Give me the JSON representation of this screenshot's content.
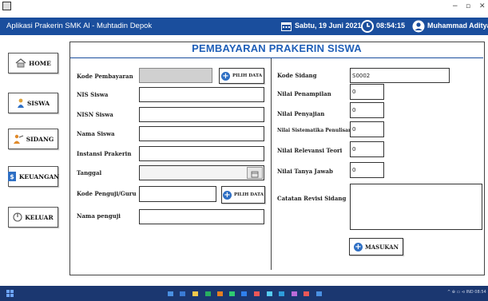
{
  "header": {
    "app_title": "Aplikasi Prakerin SMK Al - Muhtadin Depok",
    "date": "Sabtu, 19 Juni 2021",
    "time": "08:54:15",
    "user": "Muhammad Aditya"
  },
  "nav": {
    "home": "HOME",
    "siswa": "SISWA",
    "sidang": "SIDANG",
    "keuangan": "KEUANGAN",
    "keluar": "KELUAR"
  },
  "form": {
    "title": "PEMBAYARAN PRAKERIN SISWA",
    "left": {
      "kode_pembayaran": {
        "label": "Kode Pembayaran",
        "value": ""
      },
      "pilih_data_1": "PILIH DATA",
      "nis": {
        "label": "NIS Siswa",
        "value": ""
      },
      "nisn": {
        "label": "NISN Siswa",
        "value": ""
      },
      "nama": {
        "label": "Nama Siswa",
        "value": ""
      },
      "instansi": {
        "label": "Instansi Prakerin",
        "value": ""
      },
      "tanggal": {
        "label": "Tanggal",
        "value": ""
      },
      "kode_penguji": {
        "label": "Kode Penguji/Guru",
        "value": ""
      },
      "pilih_data_2": "PILIH DATA",
      "nama_penguji": {
        "label": "Nama penguji",
        "value": ""
      }
    },
    "right": {
      "kode_sidang": {
        "label": "Kode Sidang",
        "value": "S0002"
      },
      "penampilan": {
        "label": "Nilai Penampilan",
        "value": "0"
      },
      "penyajian": {
        "label": "Nilai Penyajian",
        "value": "0"
      },
      "sistematika": {
        "label": "Nilai Sistematika Penulisan",
        "value": "0"
      },
      "relevansi": {
        "label": "Nilai Relevansi Teori",
        "value": "0"
      },
      "tanya_jawab": {
        "label": "Nilai Tanya Jawab",
        "value": "0"
      },
      "catatan": {
        "label": "Catatan Revisi Sidang",
        "value": ""
      },
      "submit": "MASUKAN"
    }
  },
  "taskbar": {
    "tray": "^ ⊕ ▭ ⊲ IND 08:54"
  }
}
